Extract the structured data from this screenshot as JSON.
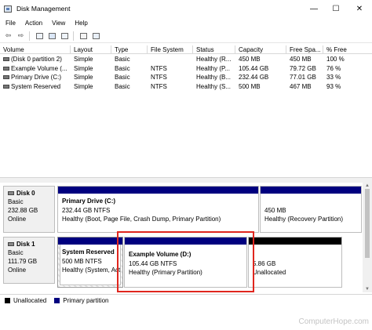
{
  "window": {
    "title": "Disk Management",
    "minimize": "—",
    "maximize": "☐",
    "close": "✕"
  },
  "menu": [
    "File",
    "Action",
    "View",
    "Help"
  ],
  "toolbar_icons": [
    "back-icon",
    "forward-icon",
    "properties-icon",
    "help-icon",
    "refresh-icon",
    "disk-list-icon"
  ],
  "volume_list": {
    "columns": [
      "Volume",
      "Layout",
      "Type",
      "File System",
      "Status",
      "Capacity",
      "Free Spa...",
      "% Free"
    ],
    "rows": [
      [
        "(Disk 0 partition 2)",
        "Simple",
        "Basic",
        "",
        "Healthy (R...",
        "450 MB",
        "450 MB",
        "100 %"
      ],
      [
        "Example Volume (...",
        "Simple",
        "Basic",
        "NTFS",
        "Healthy (P...",
        "105.44 GB",
        "79.72 GB",
        "76 %"
      ],
      [
        "Primary Drive (C:)",
        "Simple",
        "Basic",
        "NTFS",
        "Healthy (B...",
        "232.44 GB",
        "77.01 GB",
        "33 %"
      ],
      [
        "System Reserved",
        "Simple",
        "Basic",
        "NTFS",
        "Healthy (S...",
        "500 MB",
        "467 MB",
        "93 %"
      ]
    ]
  },
  "disks": [
    {
      "name": "Disk 0",
      "type": "Basic",
      "size": "232.88 GB",
      "status": "Online",
      "partitions": [
        {
          "name": "Primary Drive  (C:)",
          "detail": "232.44 GB NTFS",
          "status": "Healthy (Boot, Page File, Crash Dump, Primary Partition)"
        },
        {
          "name": "",
          "detail": "450 MB",
          "status": "Healthy (Recovery Partition)"
        }
      ]
    },
    {
      "name": "Disk 1",
      "type": "Basic",
      "size": "111.79 GB",
      "status": "Online",
      "partitions": [
        {
          "name": "System Reserved",
          "detail": "500 MB NTFS",
          "status": "Healthy (System, Act"
        },
        {
          "name": "Example Volume  (D:)",
          "detail": "105.44 GB NTFS",
          "status": "Healthy (Primary Partition)"
        },
        {
          "name": "",
          "detail": "5.86 GB",
          "status": "Unallocated"
        }
      ]
    }
  ],
  "legend": [
    "Unallocated",
    "Primary partition"
  ],
  "colors": {
    "primary_partition": "#00007f",
    "unallocated": "#000000",
    "highlight": "#e0261e"
  },
  "watermark": "ComputerHope.com"
}
